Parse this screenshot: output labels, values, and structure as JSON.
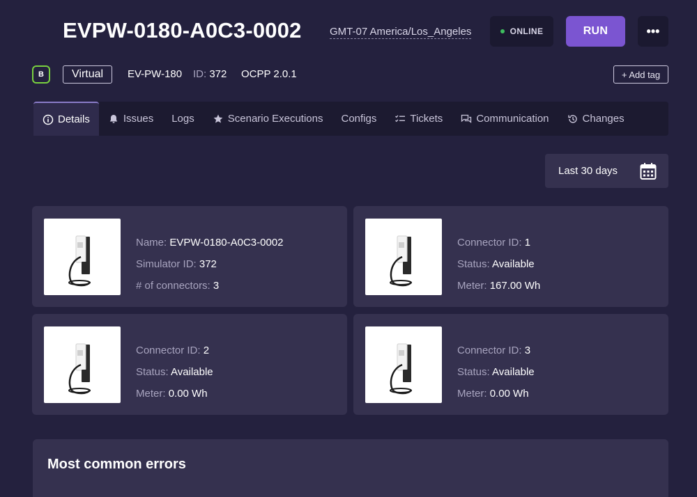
{
  "header": {
    "title": "EVPW-0180-A0C3-0002",
    "timezone": "GMT-07 America/Los_Angeles",
    "status": "ONLINE",
    "run_label": "RUN",
    "more_label": "•••"
  },
  "meta": {
    "badge": "B",
    "type_tag": "Virtual",
    "model": "EV-PW-180",
    "id_label": "ID:",
    "id_value": "372",
    "protocol": "OCPP 2.0.1",
    "add_tag_label": "+ Add tag"
  },
  "tabs": [
    {
      "label": "Details",
      "icon": "info-icon",
      "active": true
    },
    {
      "label": "Issues",
      "icon": "bell-icon",
      "active": false
    },
    {
      "label": "Logs",
      "icon": "",
      "active": false
    },
    {
      "label": "Scenario Executions",
      "icon": "star-icon",
      "active": false
    },
    {
      "label": "Configs",
      "icon": "",
      "active": false
    },
    {
      "label": "Tickets",
      "icon": "checklist-icon",
      "active": false
    },
    {
      "label": "Communication",
      "icon": "chat-icon",
      "active": false
    },
    {
      "label": "Changes",
      "icon": "history-icon",
      "active": false
    }
  ],
  "date_filter": {
    "label": "Last 30 days",
    "icon": "calendar-icon"
  },
  "cards": [
    {
      "lines": [
        {
          "label": "Name:",
          "value": "EVPW-0180-A0C3-0002"
        },
        {
          "label": "Simulator ID:",
          "value": "372"
        },
        {
          "label": "# of connectors:",
          "value": "3"
        }
      ]
    },
    {
      "lines": [
        {
          "label": "Connector ID:",
          "value": "1"
        },
        {
          "label": "Status:",
          "value": "Available"
        },
        {
          "label": "Meter:",
          "value": "167.00 Wh"
        }
      ]
    },
    {
      "lines": [
        {
          "label": "Connector ID:",
          "value": "2"
        },
        {
          "label": "Status:",
          "value": "Available"
        },
        {
          "label": "Meter:",
          "value": "0.00 Wh"
        }
      ]
    },
    {
      "lines": [
        {
          "label": "Connector ID:",
          "value": "3"
        },
        {
          "label": "Status:",
          "value": "Available"
        },
        {
          "label": "Meter:",
          "value": "0.00 Wh"
        }
      ]
    }
  ],
  "errors": {
    "title": "Most common errors"
  },
  "colors": {
    "background": "#24213e",
    "card": "#35314f",
    "accent": "#7b55d1",
    "online": "#3fbf5f",
    "badge_border": "#79d13f"
  }
}
